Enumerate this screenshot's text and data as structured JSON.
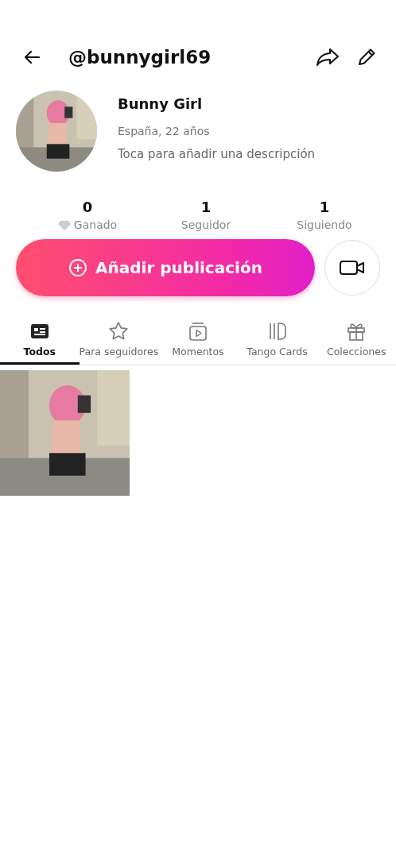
{
  "header": {
    "username": "@bunnygirl69"
  },
  "profile": {
    "name": "Bunny Girl",
    "location": "España, 22 años",
    "description_placeholder": "Toca para añadir una descripción"
  },
  "stats": [
    {
      "value": "0",
      "label": "Ganado"
    },
    {
      "value": "1",
      "label": "Seguidor"
    },
    {
      "value": "1",
      "label": "Siguiendo"
    }
  ],
  "add_post_button": "Añadir publicación",
  "tabs": [
    {
      "label": "Todos",
      "selected": true
    },
    {
      "label": "Para seguidores",
      "selected": false
    },
    {
      "label": "Momentos",
      "selected": false
    },
    {
      "label": "Tango Cards",
      "selected": false
    },
    {
      "label": "Colecciones",
      "selected": false
    }
  ]
}
